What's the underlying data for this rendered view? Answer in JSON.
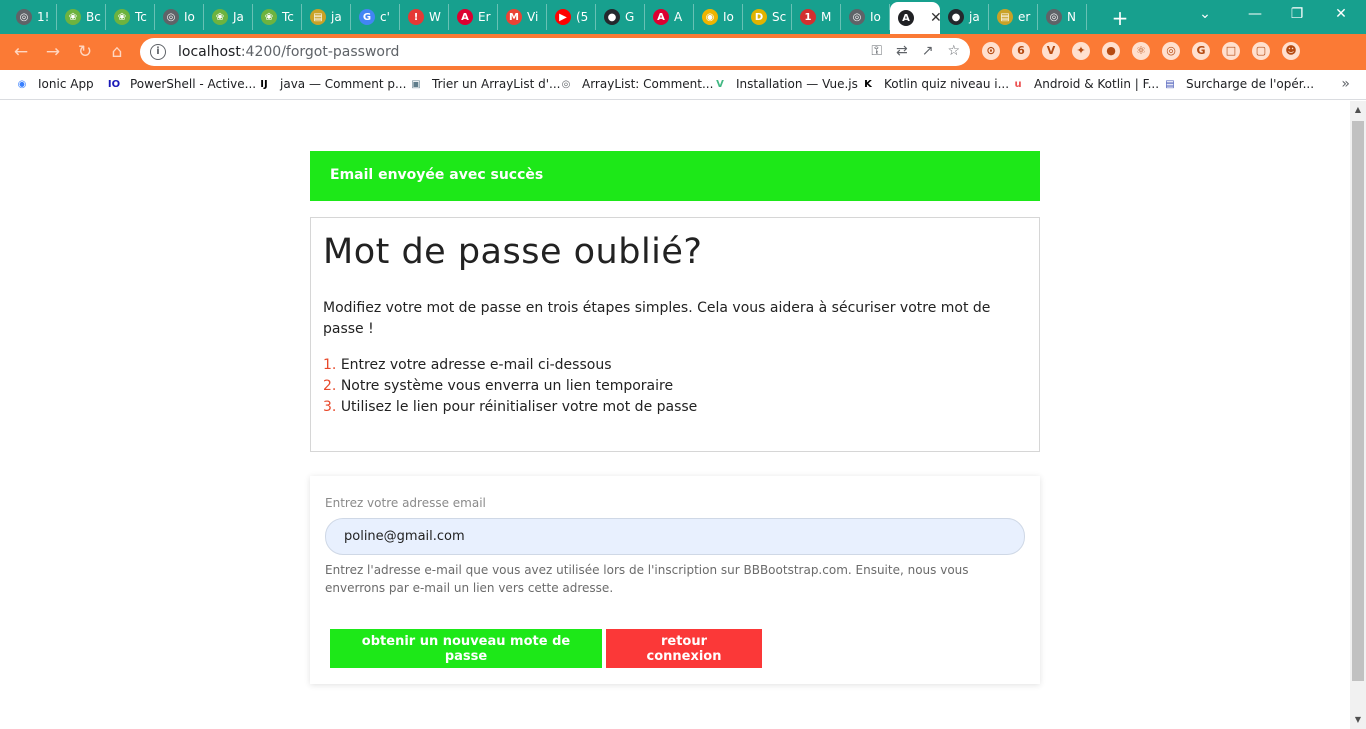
{
  "browser": {
    "tabs": [
      {
        "label": "1!",
        "icon": "globe-icon",
        "color": "#5f6368"
      },
      {
        "label": "Bc",
        "icon": "spring-leaf-icon",
        "color": "#6db33f"
      },
      {
        "label": "Tc",
        "icon": "spring-leaf-icon",
        "color": "#6db33f"
      },
      {
        "label": "Io",
        "icon": "globe-icon",
        "color": "#5f6368"
      },
      {
        "label": "Ja",
        "icon": "spring-leaf-icon",
        "color": "#6db33f"
      },
      {
        "label": "Tc",
        "icon": "spring-leaf-icon",
        "color": "#6db33f"
      },
      {
        "label": "ja",
        "icon": "book-icon",
        "color": "#c9a227"
      },
      {
        "label": "c'",
        "icon": "google-icon",
        "color": "#4285f4"
      },
      {
        "label": "W",
        "icon": "alert-icon",
        "color": "#e53935"
      },
      {
        "label": "Er",
        "icon": "angular-icon",
        "color": "#dd0031"
      },
      {
        "label": "Vi",
        "icon": "gmail-icon",
        "color": "#ea4335"
      },
      {
        "label": "(5",
        "icon": "youtube-icon",
        "color": "#ff0000"
      },
      {
        "label": "G",
        "icon": "github-icon",
        "color": "#24292e"
      },
      {
        "label": "A",
        "icon": "angular-icon",
        "color": "#dd0031"
      },
      {
        "label": "Io",
        "icon": "ionic-icon",
        "color": "#f0b400"
      },
      {
        "label": "Sc",
        "icon": "d-icon",
        "color": "#e0b300"
      },
      {
        "label": "M",
        "icon": "badge-icon",
        "color": "#d32f2f"
      },
      {
        "label": "Io",
        "icon": "globe-icon",
        "color": "#5f6368"
      },
      {
        "label": "",
        "icon": "angular-icon",
        "color": "#202124",
        "active": true
      },
      {
        "label": "ja",
        "icon": "github-icon",
        "color": "#24292e"
      },
      {
        "label": "er",
        "icon": "book-icon",
        "color": "#c9a227"
      },
      {
        "label": "N",
        "icon": "globe-icon",
        "color": "#5f6368"
      }
    ],
    "url_host": "localhost",
    "url_path": ":4200/forgot-password",
    "toolbar_color": "#fb7a35",
    "tabstrip_color": "#17a08e",
    "bookmarks": [
      {
        "label": "Ionic App",
        "icon": "ionic-icon",
        "color": "#3880ff"
      },
      {
        "label": "PowerShell - Active...",
        "icon": "io-icon",
        "color": "#1a1ab8"
      },
      {
        "label": "java — Comment p...",
        "icon": "intellij-icon",
        "color": "#000000"
      },
      {
        "label": "Trier un ArrayList d'...",
        "icon": "robot-icon",
        "color": "#607d8b"
      },
      {
        "label": "ArrayList: Comment...",
        "icon": "globe-icon",
        "color": "#5f6368"
      },
      {
        "label": "Installation — Vue.js",
        "icon": "vue-icon",
        "color": "#42b883"
      },
      {
        "label": "Kotlin quiz niveau i...",
        "icon": "kotlin-icon",
        "color": "#000000"
      },
      {
        "label": "Android & Kotlin | F...",
        "icon": "udemy-icon",
        "color": "#ec5252"
      },
      {
        "label": "Surcharge de l'opér...",
        "icon": "book-icon",
        "color": "#3f51b5"
      }
    ]
  },
  "page": {
    "alert_text": "Email envoyée avec succès",
    "title": "Mot de passe oublié?",
    "lead": "Modifiez votre mot de passe en trois étapes simples. Cela vous aidera à sécuriser votre mot de passe !",
    "steps": [
      {
        "num": "1.",
        "text": "Entrez votre adresse e-mail ci-dessous"
      },
      {
        "num": "2.",
        "text": "Notre système vous enverra un lien temporaire"
      },
      {
        "num": "3.",
        "text": "Utilisez le lien pour réinitialiser votre mot de passe"
      }
    ],
    "form": {
      "label": "Entrez votre adresse email",
      "email_value": "poline@gmail.com",
      "help": "Entrez l'adresse e-mail que vous avez utilisée lors de l'inscription sur BBBootstrap.com. Ensuite, nous vous enverrons par e-mail un lien vers cette adresse.",
      "submit_label": "obtenir un nouveau mote de passe",
      "back_label": "retour connexion"
    },
    "colors": {
      "success": "#1de818",
      "danger": "#fb3838",
      "step_number": "#e8492b"
    }
  }
}
